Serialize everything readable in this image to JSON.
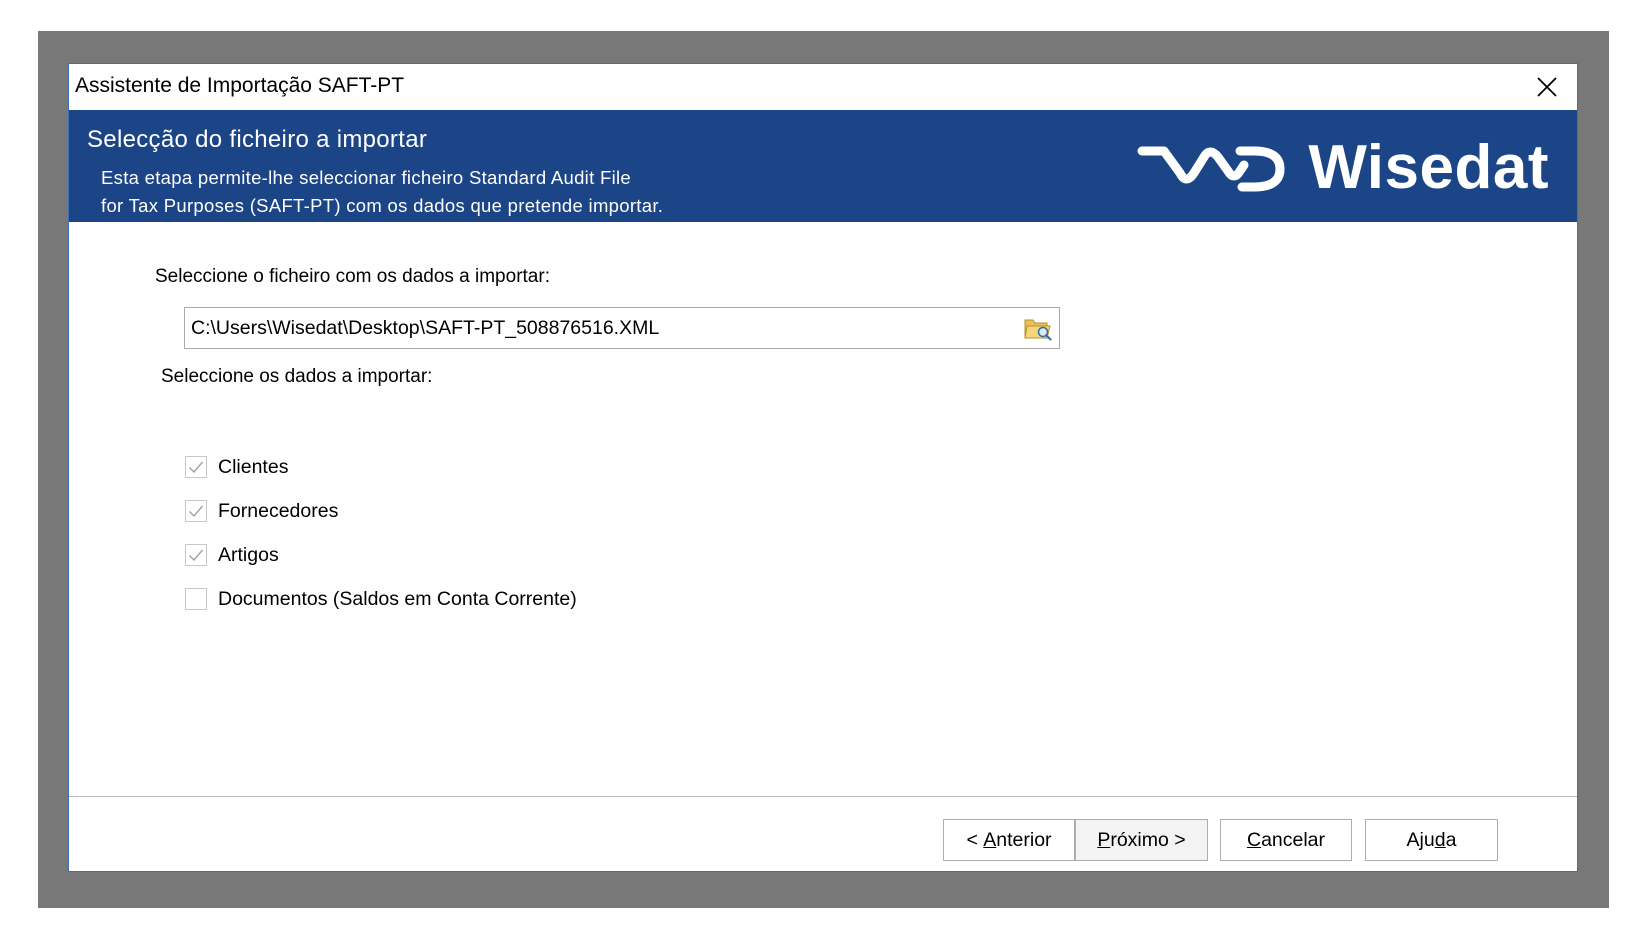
{
  "window": {
    "title": "Assistente de Importação SAFT-PT"
  },
  "header": {
    "title": "Selecção do ficheiro a importar",
    "description_line1": "Esta etapa permite-lhe seleccionar ficheiro Standard Audit File",
    "description_line2": "for Tax Purposes (SAFT-PT) com os dados que pretende importar.",
    "logo_text": "Wisedat"
  },
  "file": {
    "label": "Seleccione o ficheiro com os dados a importar:",
    "path": "C:\\Users\\Wisedat\\Desktop\\SAFT-PT_508876516.XML",
    "browse_icon": "folder-search-icon"
  },
  "data_selection": {
    "label": "Seleccione os dados a importar:",
    "options": [
      {
        "label": "Clientes",
        "checked": true
      },
      {
        "label": "Fornecedores",
        "checked": true
      },
      {
        "label": "Artigos",
        "checked": true
      },
      {
        "label": "Documentos (Saldos em Conta Corrente)",
        "checked": false
      }
    ]
  },
  "buttons": {
    "previous": {
      "prefix": "< ",
      "accel": "A",
      "rest": "nterior"
    },
    "next": {
      "accel": "P",
      "rest": "róximo >"
    },
    "cancel": {
      "accel": "C",
      "rest": "ancelar"
    },
    "help": {
      "pre": "Aju",
      "accel": "d",
      "rest": "a"
    }
  },
  "colors": {
    "header_bg": "#1c4587",
    "backdrop": "#787878",
    "check_mark": "#a0a0a0"
  }
}
